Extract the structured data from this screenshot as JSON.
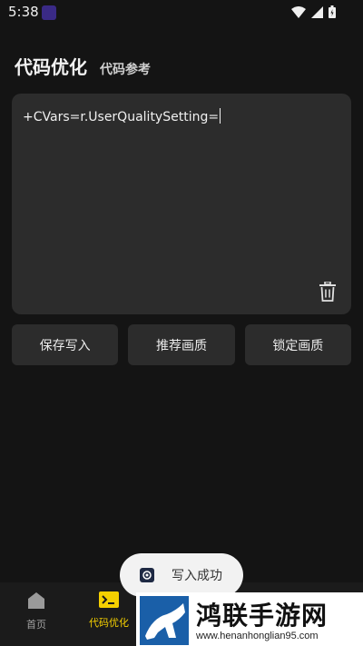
{
  "status_bar": {
    "time": "5:38"
  },
  "header": {
    "title": "代码优化",
    "ref_link": "代码参考"
  },
  "editor": {
    "value": "+CVars=r.UserQualitySetting="
  },
  "actions": {
    "save_write": "保存写入",
    "recommend_quality": "推荐画质",
    "lock_quality": "锁定画质"
  },
  "toast": {
    "message": "写入成功"
  },
  "nav": {
    "home": "首页",
    "code_opt": "代码优化"
  },
  "watermark": {
    "title": "鸿联手游网",
    "url": "www.henanhonglian95.com"
  },
  "colors": {
    "background": "#141414",
    "panel": "#2c2c2c",
    "accent": "#f5d000"
  }
}
